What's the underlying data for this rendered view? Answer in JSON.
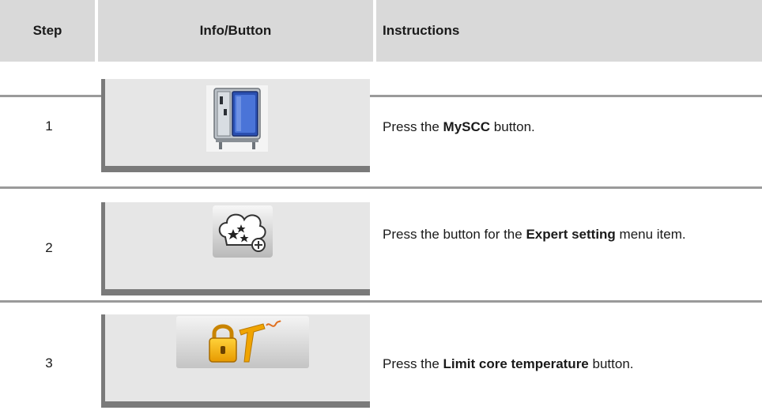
{
  "header": {
    "step": "Step",
    "info": "Info/Button",
    "instructions": "Instructions"
  },
  "rows": [
    {
      "step": "1",
      "icon": "combi-oven-icon",
      "instr_pre": "Press the ",
      "instr_bold": "MySCC",
      "instr_post": " button."
    },
    {
      "step": "2",
      "icon": "expert-setting-chef-hat-icon",
      "instr_pre": "Press the button for the ",
      "instr_bold": "Expert setting",
      "instr_post": " menu item."
    },
    {
      "step": "3",
      "icon": "limit-core-temperature-icon",
      "instr_pre": "Press the ",
      "instr_bold": "Limit core temperature",
      "instr_post": " button."
    }
  ],
  "colors": {
    "header_bg": "#d9d9d9",
    "panel_bg": "#e6e6e6",
    "panel_border": "#7a7a7a",
    "divider": "#9a9a9a"
  }
}
